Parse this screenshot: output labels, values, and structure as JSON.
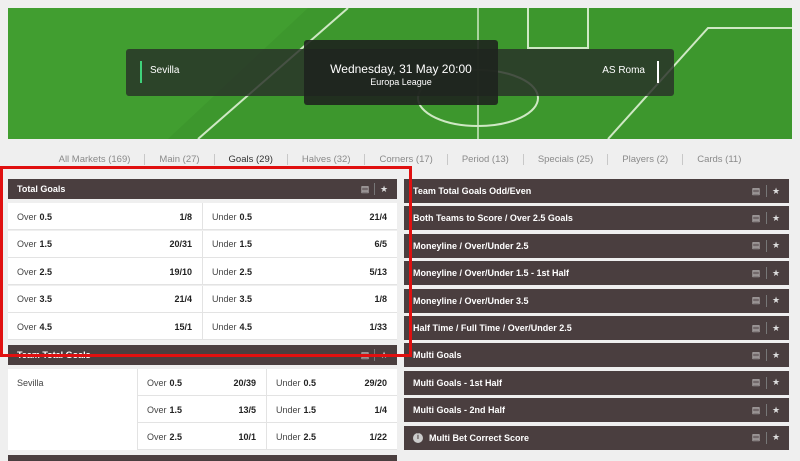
{
  "match": {
    "home_team": "Sevilla",
    "away_team": "AS Roma",
    "datetime": "Wednesday, 31 May 20:00",
    "competition": "Europa League"
  },
  "tabs": [
    {
      "label": "All Markets (169)"
    },
    {
      "label": "Main (27)"
    },
    {
      "label": "Goals (29)",
      "active": true
    },
    {
      "label": "Halves (32)"
    },
    {
      "label": "Corners (17)"
    },
    {
      "label": "Period (13)"
    },
    {
      "label": "Specials (25)"
    },
    {
      "label": "Players (2)"
    },
    {
      "label": "Cards (11)"
    }
  ],
  "total_goals": {
    "title": "Total Goals",
    "rows": [
      {
        "over_label": "Over",
        "over_line": "0.5",
        "over_odds": "1/8",
        "under_label": "Under",
        "under_line": "0.5",
        "under_odds": "21/4"
      },
      {
        "over_label": "Over",
        "over_line": "1.5",
        "over_odds": "20/31",
        "under_label": "Under",
        "under_line": "1.5",
        "under_odds": "6/5"
      },
      {
        "over_label": "Over",
        "over_line": "2.5",
        "over_odds": "19/10",
        "under_label": "Under",
        "under_line": "2.5",
        "under_odds": "5/13"
      },
      {
        "over_label": "Over",
        "over_line": "3.5",
        "over_odds": "21/4",
        "under_label": "Under",
        "under_line": "3.5",
        "under_odds": "1/8"
      },
      {
        "over_label": "Over",
        "over_line": "4.5",
        "over_odds": "15/1",
        "under_label": "Under",
        "under_line": "4.5",
        "under_odds": "1/33"
      }
    ]
  },
  "team_total_goals": {
    "title": "Team Total Goals",
    "team": "Sevilla",
    "rows": [
      {
        "over_label": "Over",
        "over_line": "0.5",
        "over_odds": "20/39",
        "under_label": "Under",
        "under_line": "0.5",
        "under_odds": "29/20"
      },
      {
        "over_label": "Over",
        "over_line": "1.5",
        "over_odds": "13/5",
        "under_label": "Under",
        "under_line": "1.5",
        "under_odds": "1/4"
      },
      {
        "over_label": "Over",
        "over_line": "2.5",
        "over_odds": "10/1",
        "under_label": "Under",
        "under_line": "2.5",
        "under_odds": "1/22"
      }
    ]
  },
  "right_markets": [
    {
      "label": "Team Total Goals Odd/Even"
    },
    {
      "label": "Both Teams to Score / Over 2.5 Goals"
    },
    {
      "label": "Moneyline / Over/Under 2.5"
    },
    {
      "label": "Moneyline / Over/Under 1.5 - 1st Half"
    },
    {
      "label": "Moneyline / Over/Under 3.5"
    },
    {
      "label": "Half Time / Full Time / Over/Under 2.5"
    },
    {
      "label": "Multi Goals"
    },
    {
      "label": "Multi Goals - 1st Half"
    },
    {
      "label": "Multi Goals - 2nd Half"
    },
    {
      "label": "Multi Bet Correct Score",
      "info": true
    }
  ],
  "icons": {
    "tv": "tv-icon",
    "star": "star-icon",
    "info": "info-icon"
  },
  "colors": {
    "panel_header": "#4a3e3f",
    "pitch": "#3f9a2e",
    "highlight": "#e01010"
  }
}
